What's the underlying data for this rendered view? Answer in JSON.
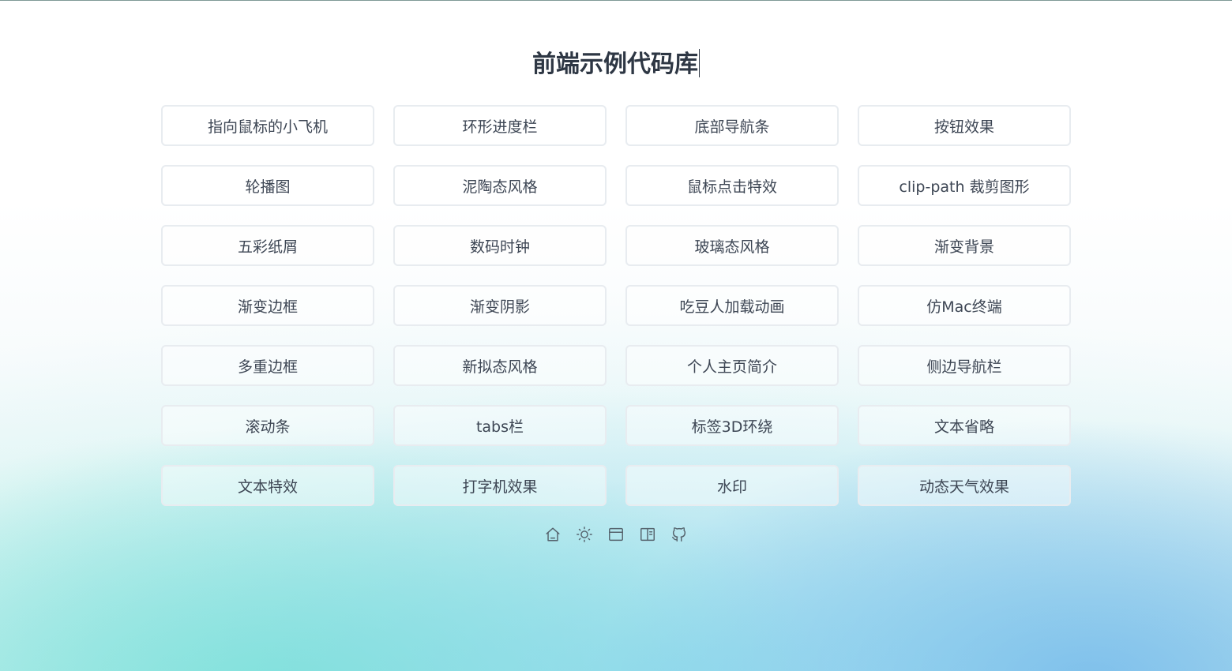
{
  "page": {
    "title": "前端示例代码库"
  },
  "cards": [
    {
      "label": "指向鼠标的小飞机"
    },
    {
      "label": "环形进度栏"
    },
    {
      "label": "底部导航条"
    },
    {
      "label": "按钮效果"
    },
    {
      "label": "轮播图"
    },
    {
      "label": "泥陶态风格"
    },
    {
      "label": "鼠标点击特效"
    },
    {
      "label": "clip-path 裁剪图形"
    },
    {
      "label": "五彩纸屑"
    },
    {
      "label": "数码时钟"
    },
    {
      "label": "玻璃态风格"
    },
    {
      "label": "渐变背景"
    },
    {
      "label": "渐变边框"
    },
    {
      "label": "渐变阴影"
    },
    {
      "label": "吃豆人加载动画"
    },
    {
      "label": "仿Mac终端"
    },
    {
      "label": "多重边框"
    },
    {
      "label": "新拟态风格"
    },
    {
      "label": "个人主页简介"
    },
    {
      "label": "侧边导航栏"
    },
    {
      "label": "滚动条"
    },
    {
      "label": "tabs栏"
    },
    {
      "label": "标签3D环绕"
    },
    {
      "label": "文本省略"
    },
    {
      "label": "文本特效"
    },
    {
      "label": "打字机效果"
    },
    {
      "label": "水印"
    },
    {
      "label": "动态天气效果"
    }
  ],
  "toolbar": {
    "icons": [
      "home-icon",
      "sun-icon",
      "window-icon",
      "book-icon",
      "github-icon"
    ]
  },
  "colors": {
    "text": "#3d4654",
    "title": "#2e3744",
    "card_border": "#e8ecf0",
    "icon": "#56646e",
    "gradient_teal": "#78e8d0",
    "gradient_blue": "#68aae8"
  }
}
